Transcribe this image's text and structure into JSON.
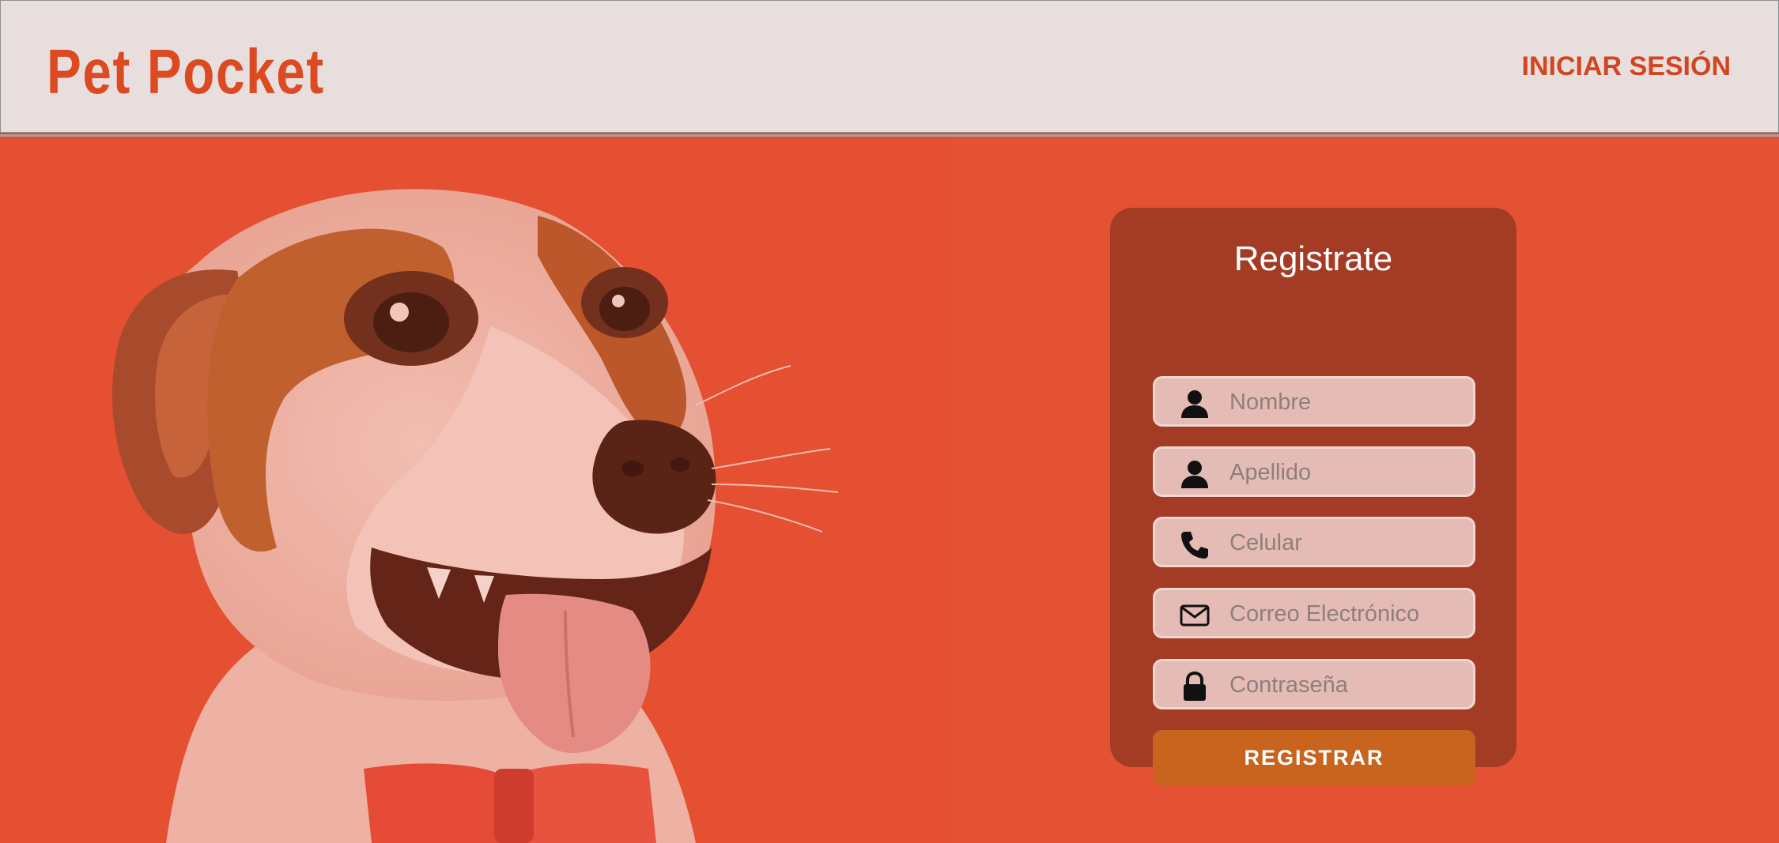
{
  "header": {
    "logo": "Pet Pocket",
    "login_link": "INICIAR SESIÓN"
  },
  "form": {
    "title": "Registrate",
    "fields": [
      {
        "placeholder": "Nombre",
        "icon": "user-icon"
      },
      {
        "placeholder": "Apellido",
        "icon": "user-icon"
      },
      {
        "placeholder": "Celular",
        "icon": "phone-icon"
      },
      {
        "placeholder": "Correo Electrónico",
        "icon": "envelope-icon"
      },
      {
        "placeholder": "Contraseña",
        "icon": "lock-icon"
      }
    ],
    "submit_label": "REGISTRAR"
  },
  "colors": {
    "brand": "#dc4a22",
    "hero_background": "#e55133",
    "panel": "#a43b25",
    "button": "#c8641d",
    "header_background": "#e8dede"
  }
}
